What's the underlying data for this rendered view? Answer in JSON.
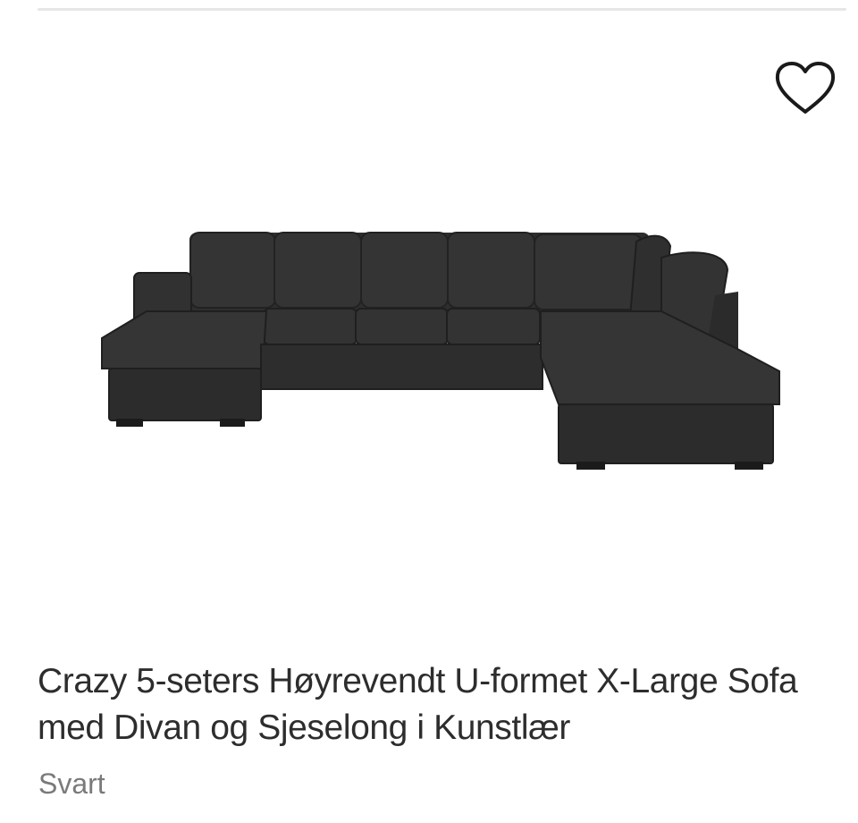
{
  "product": {
    "title": "Crazy 5-seters Høyrevendt U-formet X-Large Sofa med Divan og Sjeselong i Kunstlær",
    "variant": "Svart",
    "image_alt": "sofa-image"
  },
  "wishlist": {
    "icon": "heart-outline-icon"
  },
  "colors": {
    "divider": "#e6e6e6",
    "title": "#2d2d2d",
    "variant": "#7a7a7a",
    "sofa": "#2f2f2f"
  }
}
